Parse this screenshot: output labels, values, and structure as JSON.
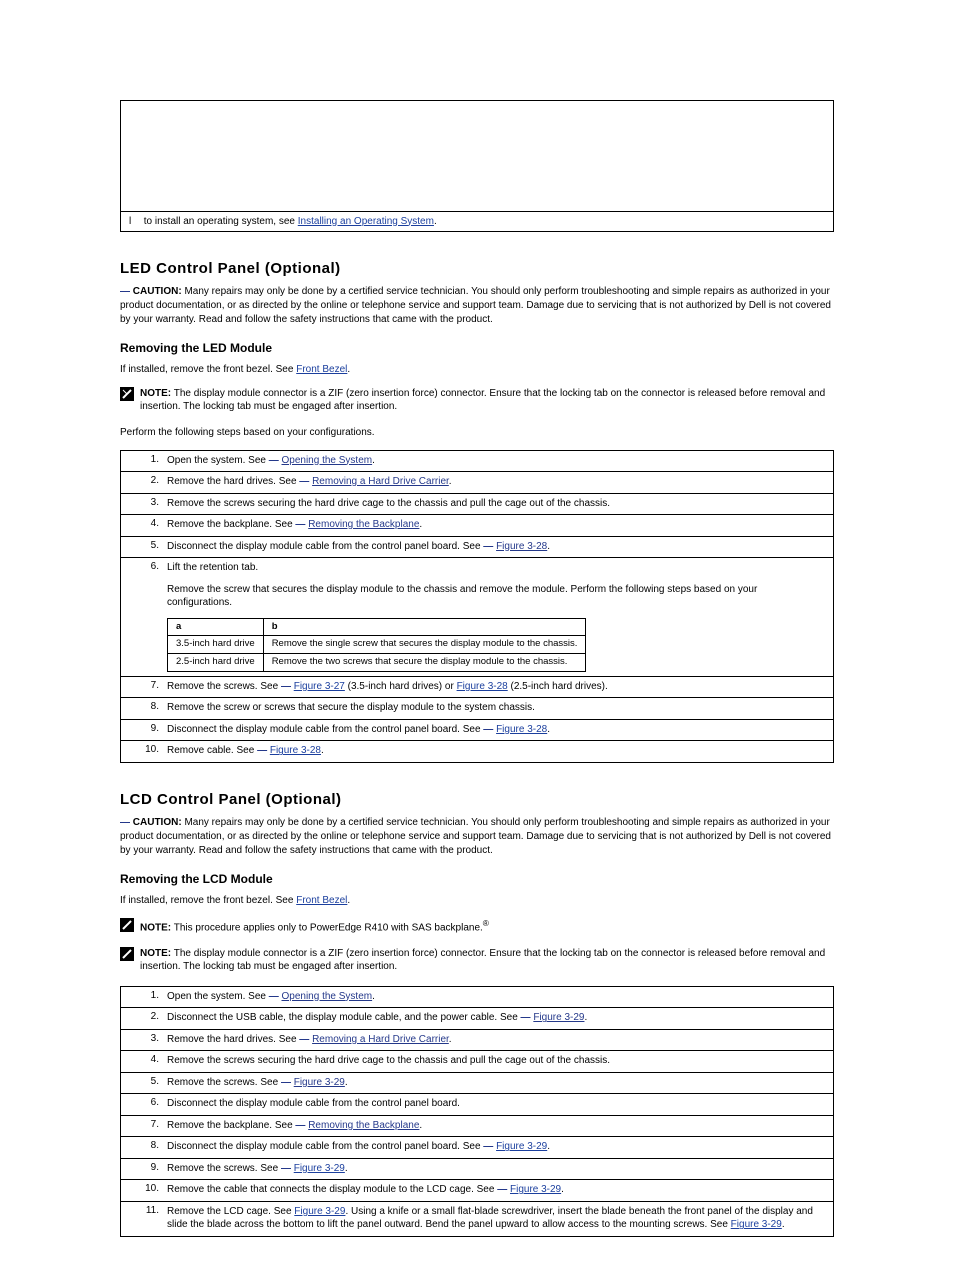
{
  "topbox": {
    "li_prefix": "l",
    "li_text": "to install an operating system, see",
    "li_link": "Installing an Operating System"
  },
  "s1": {
    "heading": "LED Control Panel (Optional)",
    "subheading": "Removing the LED Module",
    "caution": {
      "label": "CAUTION:",
      "text_before": "Many repairs may only be done by a certified service technician. You should only perform troubleshooting and simple repairs as authorized in your product documentation, or as directed by the online or telephone service and support team. Damage due to servicing that is not authorized by Dell is not covered by your warranty. Read and follow the safety instructions that came with the product."
    },
    "intro": "If installed, remove the front bezel. See",
    "intro_link": "Front Bezel",
    "note": {
      "label": "NOTE:",
      "text_before": "The display module connector is a ZIF (zero insertion force) connector. Ensure that the locking tab on the connector is released before removal and insertion. The locking tab must be engaged after insertion."
    },
    "post_note_intro": "Perform the following steps based on your configurations.",
    "steps": [
      {
        "n": "1.",
        "text": "Open the system. See ",
        "link": "Opening the System"
      },
      {
        "n": "2.",
        "text": "Remove the hard drives. See ",
        "link": "Removing a Hard Drive Carrier"
      },
      {
        "n": "3.",
        "text": "Remove the screws securing the hard drive cage to the chassis and pull the cage out of the chassis."
      },
      {
        "n": "4.",
        "text": "Remove the backplane. See ",
        "link": "Removing the Backplane"
      },
      {
        "n": "5.",
        "text": "Disconnect the display module cable from the control panel board. See ",
        "link": "Figure 3-28"
      },
      {
        "n": "6.",
        "text": "Lift the retention tab.<br>Remove the screw that secures the display module to the chassis and remove the module. Perform the following steps based on your configurations.",
        "inner": {
          "headers": [
            "a",
            "b"
          ],
          "rows": [
            [
              "3.5-inch hard drive",
              "Remove the single screw that secures the display module to the chassis."
            ],
            [
              "2.5-inch hard drive",
              "Remove the two screws that secure the display module to the chassis."
            ]
          ]
        }
      },
      {
        "n": "7.",
        "text": "Remove the screws. See ",
        "link": "Figure 3-27",
        "text2": " (3.5-inch hard drives) or ",
        "link2": "Figure 3-28",
        "text3": " (2.5-inch hard drives)."
      },
      {
        "n": "8.",
        "text": "Remove the screw or screws that secure the display module to the system chassis."
      },
      {
        "n": "9.",
        "text": "Disconnect the display module cable from the control panel board. See ",
        "link": "Figure 3-28"
      },
      {
        "n": "10.",
        "text": "Remove cable. See ",
        "link": "Figure 3-28"
      }
    ]
  },
  "s2": {
    "heading": "LCD Control Panel (Optional)",
    "subheading": "Removing the LCD Module",
    "caution": {
      "label": "CAUTION:",
      "text_before": "Many repairs may only be done by a certified service technician. You should only perform troubleshooting and simple repairs as authorized in your product documentation, or as directed by the online or telephone service and support team. Damage due to servicing that is not authorized by Dell is not covered by your warranty. Read and follow the safety instructions that came with the product."
    },
    "intro": "If installed, remove the front bezel. See",
    "intro_link": "Front Bezel",
    "note": {
      "label": "NOTE:",
      "text": "This procedure applies only to PowerEdge R410 with SAS backplane."
    },
    "note2": {
      "label": "NOTE:",
      "text_before": "The display module connector is a ZIF (zero insertion force) connector. Ensure that the locking tab on the connector is released before removal and insertion. The locking tab must be engaged after insertion."
    },
    "re_sym": "®",
    "steps": [
      {
        "n": "1.",
        "text": "Open the system. See ",
        "link": "Opening the System"
      },
      {
        "n": "2.",
        "text": "Disconnect the USB cable, the display module cable, and the power cable. See ",
        "link": "Figure 3-29"
      },
      {
        "n": "3.",
        "text": "Remove the hard drives. See ",
        "link": "Removing a Hard Drive Carrier"
      },
      {
        "n": "4.",
        "text": "Remove the screws securing the hard drive cage to the chassis and pull the cage out of the chassis."
      },
      {
        "n": "5.",
        "text": "Remove the screws. See ",
        "link": "Figure 3-29"
      },
      {
        "n": "6.",
        "text": "Disconnect the display module cable from the control panel board."
      },
      {
        "n": "7.",
        "text": "Remove the backplane. See ",
        "link": "Removing the Backplane"
      },
      {
        "n": "8.",
        "text": "Disconnect the display module cable from the control panel board. See ",
        "link": "Figure 3-29"
      },
      {
        "n": "9.",
        "text": "Remove the screws. See ",
        "link": "Figure 3-29"
      },
      {
        "n": "10.",
        "text": "Remove the cable that connects the display module to the LCD cage. See ",
        "link": "Figure 3-29"
      },
      {
        "n": "11.",
        "text": "Remove the LCD cage. See ",
        "link": "Figure 3-29",
        "tail": ". Using a knife or a small flat-blade screwdriver, insert the blade beneath the front panel of the display and slide the blade across the bottom to lift the panel outward. Bend the panel upward to allow access to the mounting screws. See ",
        "link2": "Figure 3-29"
      }
    ]
  }
}
